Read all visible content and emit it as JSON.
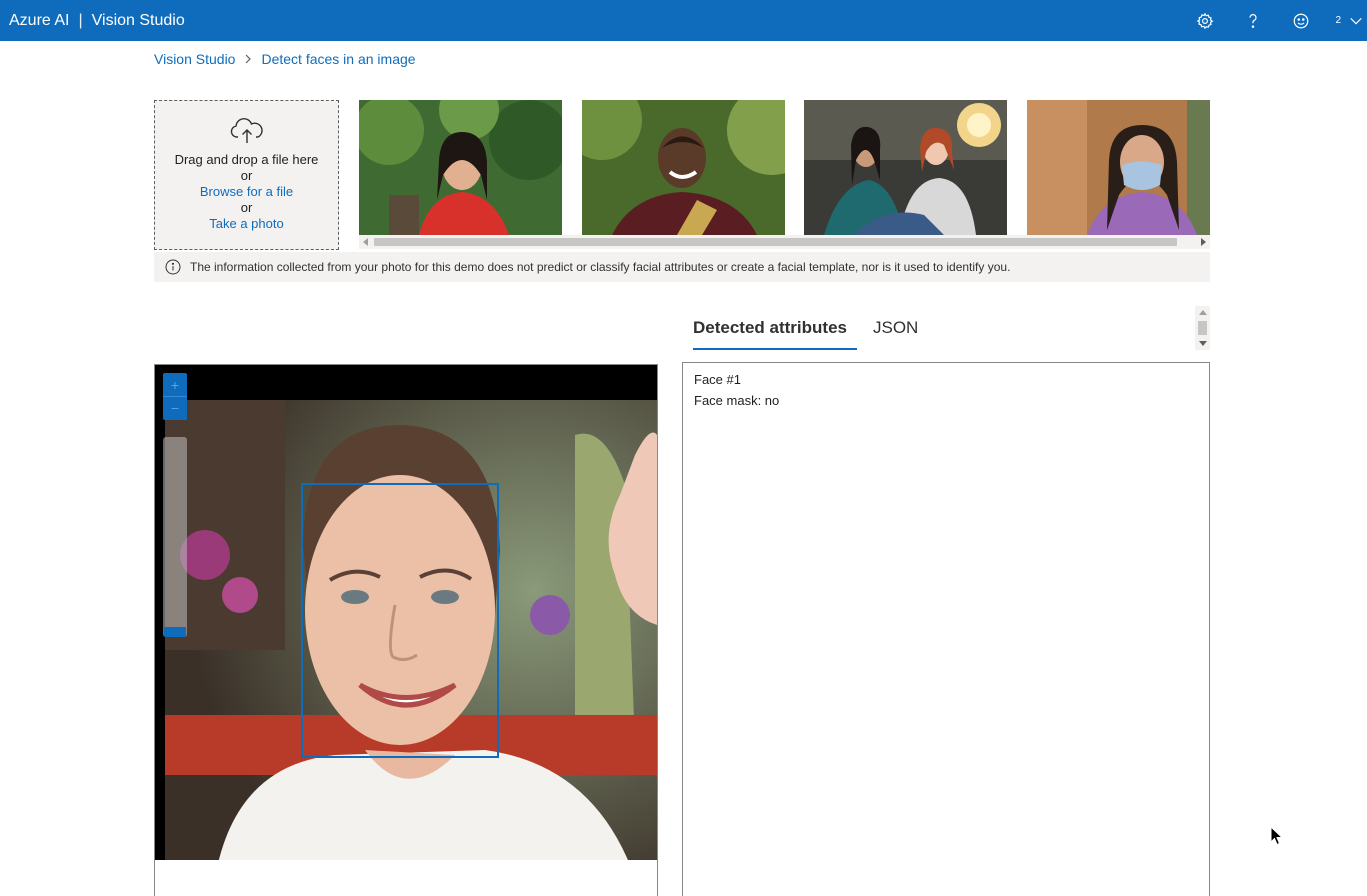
{
  "header": {
    "brand": "Azure AI",
    "separator": "|",
    "product": "Vision Studio",
    "icons": [
      "settings-icon",
      "help-icon",
      "feedback-smiley-icon"
    ],
    "account_badge": "2",
    "background_color": "#0f6cbd"
  },
  "breadcrumb": {
    "items": [
      {
        "label": "Vision Studio"
      },
      {
        "label": "Detect faces in an image"
      }
    ]
  },
  "upload": {
    "drag_text": "Drag and drop a file here",
    "or_1": "or",
    "browse_link": "Browse for a file",
    "or_2": "or",
    "photo_link": "Take a photo"
  },
  "gallery": {
    "samples": [
      {
        "id": "sample-1"
      },
      {
        "id": "sample-2"
      },
      {
        "id": "sample-3"
      },
      {
        "id": "sample-4"
      }
    ]
  },
  "info": {
    "text": "The information collected from your photo for this demo does not predict or classify facial attributes or create a facial template, nor is it used to identify you."
  },
  "viewer": {
    "zoom_in": "+",
    "zoom_out": "−"
  },
  "results": {
    "tabs": [
      {
        "label": "Detected attributes",
        "active": true
      },
      {
        "label": "JSON",
        "active": false
      }
    ],
    "lines": [
      "Face #1",
      "Face mask: no"
    ]
  },
  "colors": {
    "accent": "#0f6cbd",
    "panel_bg": "#f3f2f1"
  }
}
